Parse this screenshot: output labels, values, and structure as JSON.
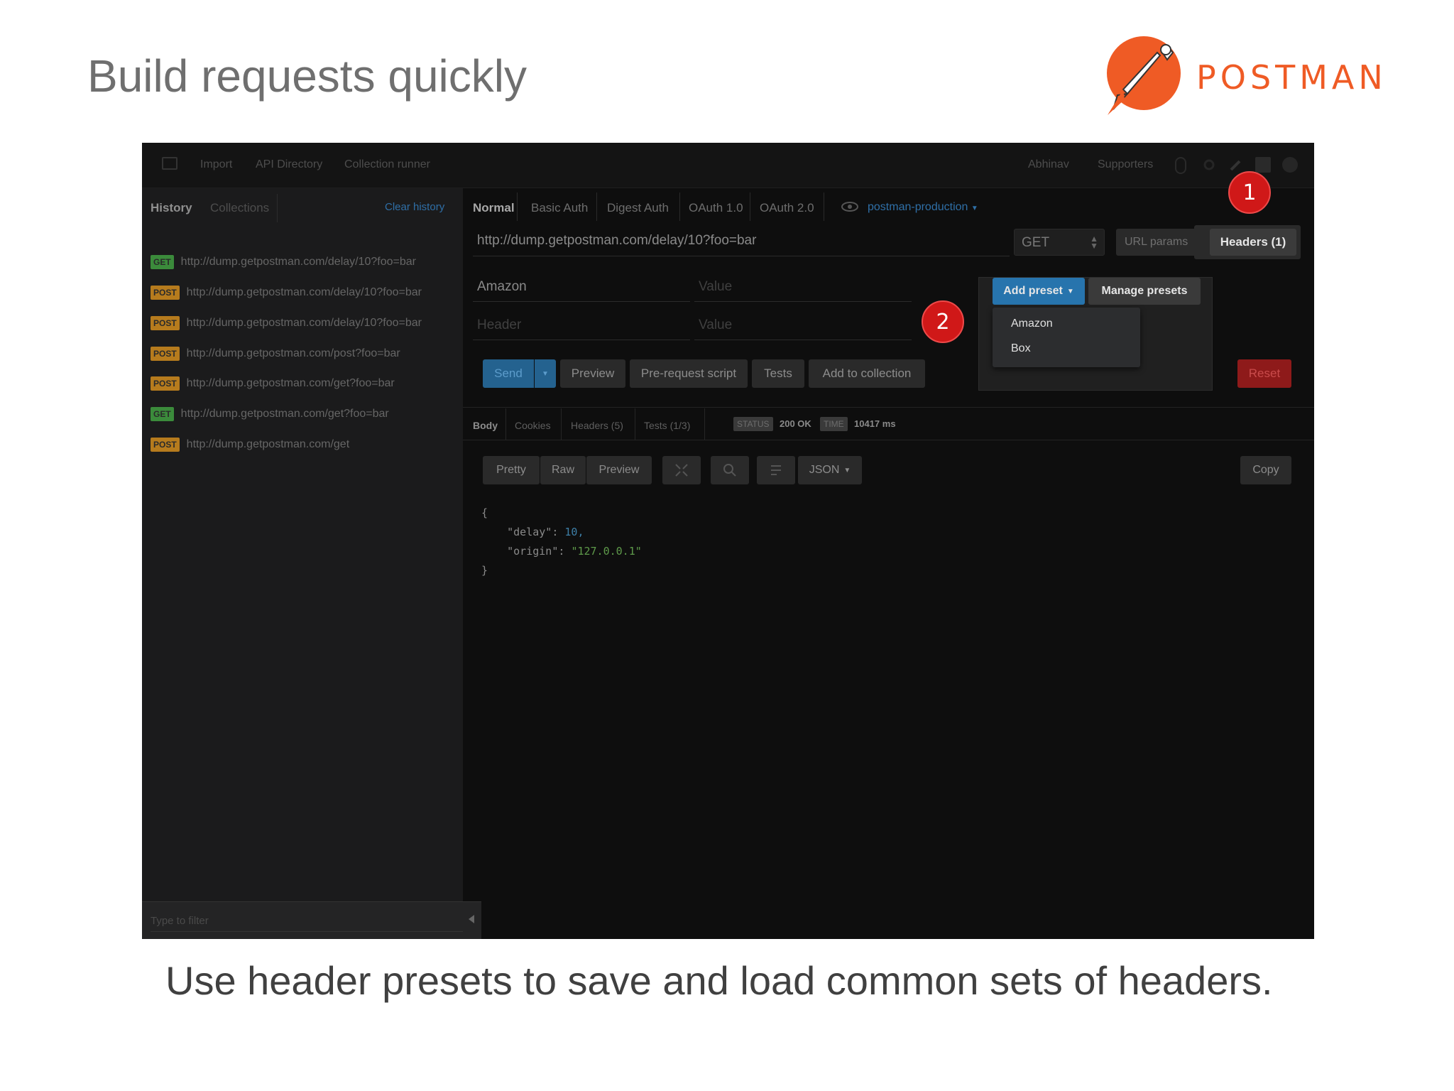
{
  "slide": {
    "title": "Build requests quickly",
    "logo_text": "POSTMAN",
    "caption": "Use header presets to save and load common sets of headers."
  },
  "topbar": {
    "items": [
      "Import",
      "API Directory",
      "Collection runner"
    ],
    "user": "Abhinav",
    "supporters": "Supporters"
  },
  "sidebar": {
    "tabs": [
      "History",
      "Collections"
    ],
    "clear_label": "Clear history",
    "filter_placeholder": "Type to filter",
    "history": [
      {
        "method": "GET",
        "url": "http://dump.getpostman.com/delay/10?foo=bar"
      },
      {
        "method": "POST",
        "url": "http://dump.getpostman.com/delay/10?foo=bar"
      },
      {
        "method": "POST",
        "url": "http://dump.getpostman.com/delay/10?foo=bar"
      },
      {
        "method": "POST",
        "url": "http://dump.getpostman.com/post?foo=bar"
      },
      {
        "method": "POST",
        "url": "http://dump.getpostman.com/get?foo=bar"
      },
      {
        "method": "GET",
        "url": "http://dump.getpostman.com/get?foo=bar"
      },
      {
        "method": "POST",
        "url": "http://dump.getpostman.com/get"
      }
    ]
  },
  "auth_tabs": [
    "Normal",
    "Basic Auth",
    "Digest Auth",
    "OAuth 1.0",
    "OAuth 2.0"
  ],
  "environment": "postman-production",
  "request": {
    "url": "http://dump.getpostman.com/delay/10?foo=bar",
    "method": "GET",
    "url_params_label": "URL params",
    "headers_label": "Headers (1)"
  },
  "headers": {
    "rows": [
      {
        "key": "Amazon",
        "value": ""
      },
      {
        "key": "",
        "value": ""
      }
    ],
    "key_placeholder": "Header",
    "value_placeholder": "Value"
  },
  "presets": {
    "add_label": "Add preset",
    "manage_label": "Manage presets",
    "items": [
      "Amazon",
      "Box"
    ]
  },
  "actions": {
    "send": "Send",
    "preview": "Preview",
    "prerequest": "Pre-request script",
    "tests": "Tests",
    "add_collection": "Add to collection",
    "reset": "Reset"
  },
  "markers": [
    "1",
    "2"
  ],
  "response": {
    "tabs": [
      "Body",
      "Cookies",
      "Headers (5)",
      "Tests (1/3)"
    ],
    "status_label": "STATUS",
    "status_value": "200 OK",
    "time_label": "TIME",
    "time_value": "10417 ms",
    "view_modes": [
      "Pretty",
      "Raw",
      "Preview"
    ],
    "format": "JSON",
    "copy_label": "Copy",
    "body": {
      "open": "{",
      "line1_key": "\"delay\": ",
      "line1_val": "10,",
      "line2_key": "\"origin\": ",
      "line2_val": "\"127.0.0.1\"",
      "close": "}"
    }
  },
  "colors": {
    "postman_orange": "#ef5b25",
    "send_blue": "#24628f",
    "reset_red": "#8e1a1a",
    "marker_red": "#d01818"
  }
}
